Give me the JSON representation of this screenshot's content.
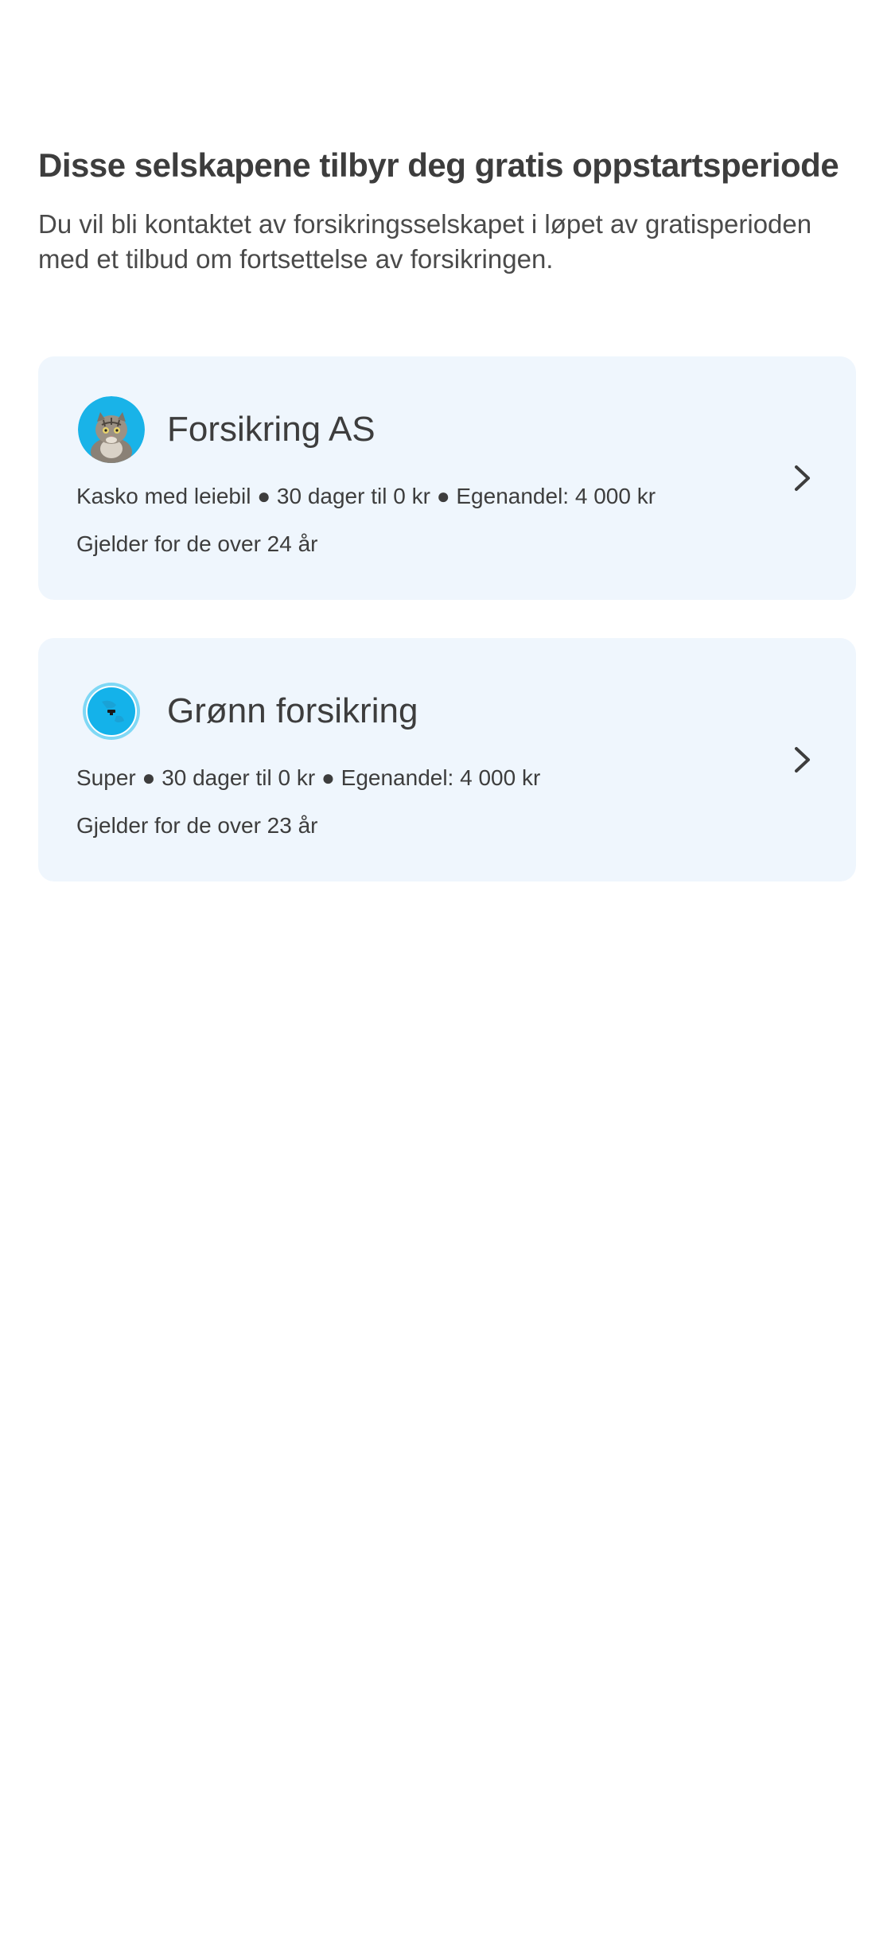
{
  "header": {
    "title": "Disse selskapene tilbyr deg gratis oppstartsperiode",
    "subtitle": "Du vil bli kontaktet av forsikringsselskapet i løpet av gratisperioden med et tilbud om fortsettelse av forsikringen."
  },
  "offers": [
    {
      "company": "Forsikring AS",
      "logo_icon": "cat-avatar-icon",
      "details": "Kasko med leiebil ● 30 dager til 0 kr ● Egenandel: 4 000 kr",
      "age_requirement": "Gjelder for de over 24 år"
    },
    {
      "company": "Grønn forsikring",
      "logo_icon": "blue-globe-logo-icon",
      "details": "Super ● 30 dager til 0 kr ● Egenandel: 4 000 kr",
      "age_requirement": "Gjelder for de over 23 år"
    }
  ],
  "colors": {
    "card_background": "#eff6fd",
    "text": "#3d3d3d",
    "logo_blue": "#1ab4ea"
  }
}
